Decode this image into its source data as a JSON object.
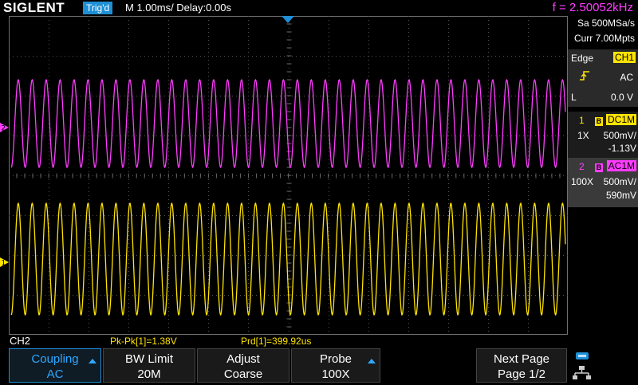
{
  "header": {
    "logo": "SIGLENT",
    "trig_status": "Trig'd",
    "timebase": "M 1.00ms/ Delay:0.00s",
    "frequency": "f = 2.50052kHz"
  },
  "acquisition": {
    "sample_rate": "Sa 500MSa/s",
    "memory_depth": "Curr 7.00Mpts"
  },
  "trigger": {
    "type": "Edge",
    "source": "CH1",
    "coupling": "AC",
    "level_label": "L",
    "level": "0.0 V"
  },
  "channels": [
    {
      "number": "1",
      "bw_badge": "B",
      "coupling": "DC1M",
      "probe": "1X",
      "scale": "500mV/",
      "offset": "-1.13V",
      "color": "#ffe400",
      "marker": "1"
    },
    {
      "number": "2",
      "bw_badge": "B",
      "coupling": "AC1M",
      "probe": "100X",
      "scale": "500mV/",
      "offset": "590mV",
      "color": "#ff3cff",
      "marker": "2"
    }
  ],
  "measurements": {
    "channel_label": "CH2",
    "pkpk": "Pk-Pk[1]=1.38V",
    "period": "Prd[1]=399.92us"
  },
  "softkeys": [
    {
      "line1": "Coupling",
      "line2": "AC"
    },
    {
      "line1": "BW Limit",
      "line2": "20M"
    },
    {
      "line1": "Adjust",
      "line2": "Coarse"
    },
    {
      "line1": "Probe",
      "line2": "100X"
    },
    {
      "line1": "Next Page",
      "line2": "Page 1/2"
    }
  ],
  "icons": {
    "trigger_edge": "rising-edge-icon",
    "trigger_position": "trigger-position-icon",
    "usb": "usb-icon",
    "network": "network-icon"
  }
}
